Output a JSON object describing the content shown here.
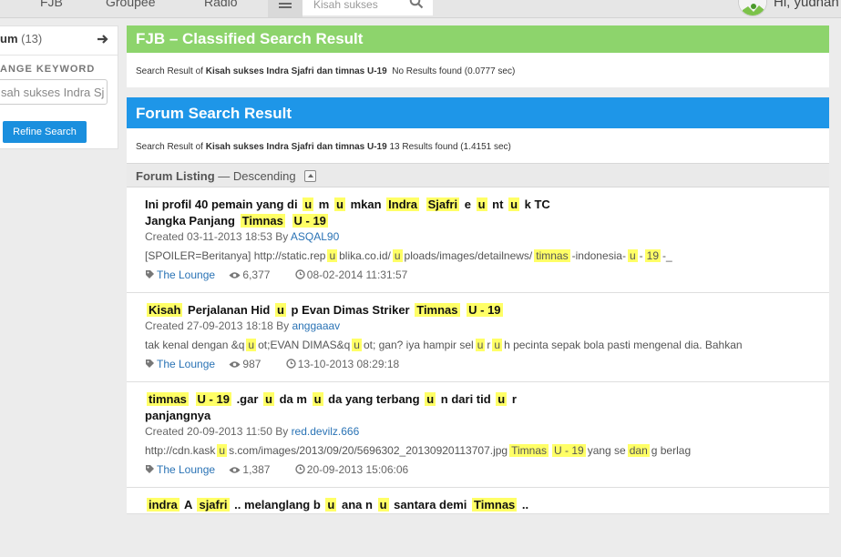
{
  "topbar": {
    "nav": [
      "FJB",
      "Groupee",
      "Radio"
    ],
    "search_placeholder": "Kisah sukses",
    "greeting": "Hi, yudhan"
  },
  "sidebar": {
    "forum_label": "um",
    "forum_count": "(13)",
    "keyword_label": "ANGE KEYWORD",
    "keyword_value": "sah sukses Indra Sj",
    "refine_label": "Refine Search"
  },
  "fjb": {
    "title": "FJB – Classified Search Result",
    "prefix": "Search Result of",
    "query": "Kisah sukses Indra Sjafri dan timnas U-19",
    "summary": "No Results found (0.0777 sec)"
  },
  "forum": {
    "title": "Forum Search Result",
    "prefix": "Search Result of",
    "query": "Kisah sukses Indra Sjafri dan timnas U-19",
    "summary": "13 Results found (1.4151 sec)",
    "listing_label": "Forum Listing",
    "listing_order": "— Descending"
  },
  "results": [
    {
      "title_line1": [
        [
          "t",
          "Ini profil 40 pemain yang di"
        ],
        [
          "h",
          "u"
        ],
        [
          "t",
          "m"
        ],
        [
          "h",
          "u"
        ],
        [
          "t",
          "mkan"
        ],
        [
          "h",
          "Indra"
        ],
        [
          "h",
          "Sjafri"
        ],
        [
          "t",
          "e"
        ],
        [
          "h",
          "u"
        ],
        [
          "t",
          "nt"
        ],
        [
          "h",
          "u"
        ],
        [
          "t",
          "k TC"
        ]
      ],
      "title_line2": [
        [
          "t",
          "Jangka Panjang"
        ],
        [
          "h",
          "Timnas"
        ],
        [
          "h",
          "U - 19"
        ]
      ],
      "created_text": "Created 03-11-2013 18:53 By",
      "author": "ASQAL90",
      "snippet": [
        [
          "t",
          "[SPOILER=Beritanya] http://static.rep"
        ],
        [
          "h",
          "u"
        ],
        [
          "t",
          "blika.co.id/"
        ],
        [
          "h",
          "u"
        ],
        [
          "t",
          "ploads/images/detailnews/"
        ],
        [
          "h",
          "timnas"
        ],
        [
          "t",
          "-indonesia-"
        ],
        [
          "h",
          "u"
        ],
        [
          "t",
          "-"
        ],
        [
          "h",
          "19"
        ],
        [
          "t",
          "-_"
        ]
      ],
      "forum": "The Lounge",
      "views": "6,377",
      "last_post": "08-02-2014 11:31:57"
    },
    {
      "title_line1": [
        [
          "h",
          "Kisah"
        ],
        [
          "t",
          "Perjalanan Hid"
        ],
        [
          "h",
          "u"
        ],
        [
          "t",
          "p Evan Dimas Striker"
        ],
        [
          "h",
          "Timnas"
        ],
        [
          "h",
          "U - 19"
        ]
      ],
      "title_line2": [],
      "created_text": "Created 27-09-2013 18:18 By",
      "author": "anggaaav",
      "snippet": [
        [
          "t",
          "tak kenal dengan &q"
        ],
        [
          "h",
          "u"
        ],
        [
          "t",
          "ot;EVAN DIMAS&q"
        ],
        [
          "h",
          "u"
        ],
        [
          "t",
          "ot; gan? iya hampir sel"
        ],
        [
          "h",
          "u"
        ],
        [
          "t",
          "r"
        ],
        [
          "h",
          "u"
        ],
        [
          "t",
          "h pecinta sepak bola pasti mengenal dia. Bahkan"
        ]
      ],
      "forum": "The Lounge",
      "views": "987",
      "last_post": "13-10-2013 08:29:18"
    },
    {
      "title_line1": [
        [
          "h",
          "timnas"
        ],
        [
          "h",
          "U - 19"
        ],
        [
          "t",
          ".gar"
        ],
        [
          "h",
          "u"
        ],
        [
          "t",
          "da m"
        ],
        [
          "h",
          "u"
        ],
        [
          "t",
          "da yang terbang"
        ],
        [
          "h",
          "u"
        ],
        [
          "t",
          "n dari tid"
        ],
        [
          "h",
          "u"
        ],
        [
          "t",
          "r"
        ]
      ],
      "title_line2": [
        [
          "t",
          "panjangnya"
        ]
      ],
      "created_text": "Created 20-09-2013 11:50 By",
      "author": "red.devilz.666",
      "snippet": [
        [
          "t",
          "http://cdn.kask"
        ],
        [
          "h",
          "u"
        ],
        [
          "t",
          "s.com/images/2013/09/20/5696302_20130920113707.jpg"
        ],
        [
          "h",
          "Timnas"
        ],
        [
          "h",
          "U - 19"
        ],
        [
          "t",
          "yang se"
        ],
        [
          "h",
          "dan"
        ],
        [
          "t",
          "g berlag"
        ]
      ],
      "forum": "The Lounge",
      "views": "1,387",
      "last_post": "20-09-2013 15:06:06"
    },
    {
      "title_line1": [
        [
          "h",
          "indra"
        ],
        [
          "t",
          "A"
        ],
        [
          "h",
          "sjafri"
        ],
        [
          "t",
          ".. melanglang b"
        ],
        [
          "h",
          "u"
        ],
        [
          "t",
          "ana n"
        ],
        [
          "h",
          "u"
        ],
        [
          "t",
          "santara demi"
        ],
        [
          "h",
          "Timnas"
        ],
        [
          "t",
          ".."
        ]
      ],
      "title_line2": [],
      "created_text": "",
      "author": "",
      "snippet": [],
      "forum": "",
      "views": "",
      "last_post": ""
    }
  ]
}
